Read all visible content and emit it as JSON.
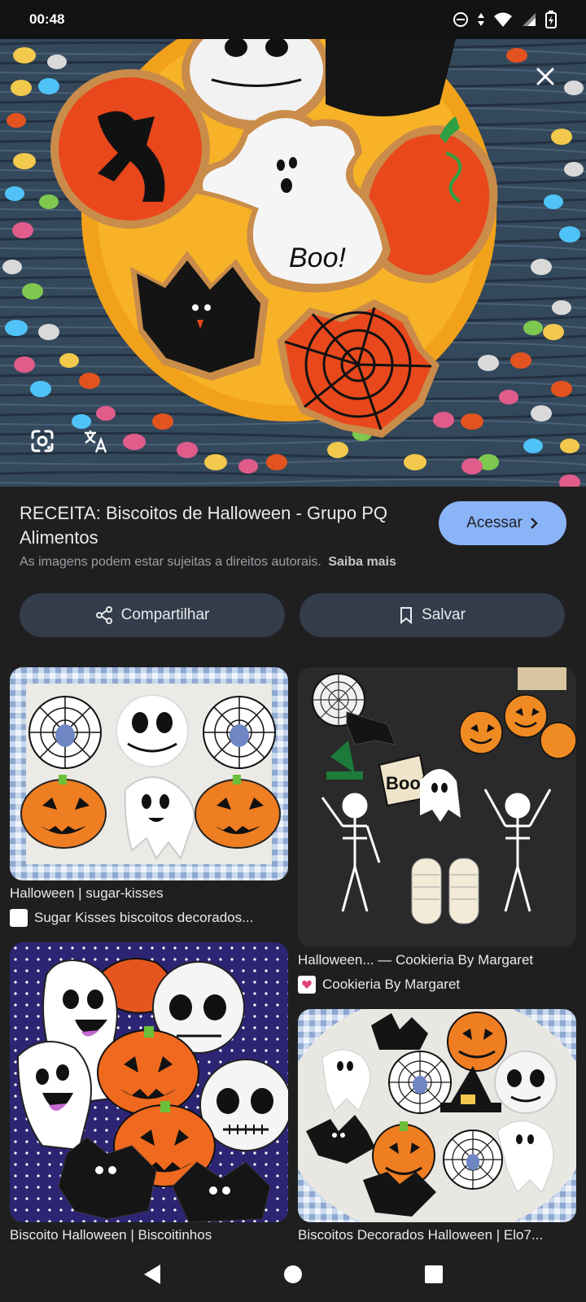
{
  "status_bar": {
    "time": "00:48",
    "icons": [
      "do-not-disturb-icon",
      "data-arrows-icon",
      "wifi-icon",
      "signal-icon",
      "battery-charging-icon"
    ]
  },
  "result": {
    "title": "RECEITA: Biscoitos de Halloween - Grupo PQ Alimentos",
    "access_label": "Acessar",
    "copyright_notice": "As imagens podem estar sujeitas a direitos autorais.",
    "learn_more": "Saiba mais",
    "hero_text": "Boo!"
  },
  "actions": {
    "share_label": "Compartilhar",
    "save_label": "Salvar"
  },
  "related": [
    {
      "title": "Halloween | sugar-kisses",
      "source": "Sugar Kisses biscoitos decorados..."
    },
    {
      "title": "Halloween... — Cookieria By Margaret",
      "source": "Cookieria By Margaret",
      "image_text": "Boo!"
    },
    {
      "title": "Biscoito Halloween | Biscoitinhos",
      "source": ""
    },
    {
      "title": "Biscoitos Decorados Halloween | Elo7...",
      "source": ""
    }
  ],
  "colors": {
    "background": "#1f1f1f",
    "accent": "#8ab4f8",
    "pill": "#333c4a",
    "muted_text": "#9aa0a6"
  }
}
